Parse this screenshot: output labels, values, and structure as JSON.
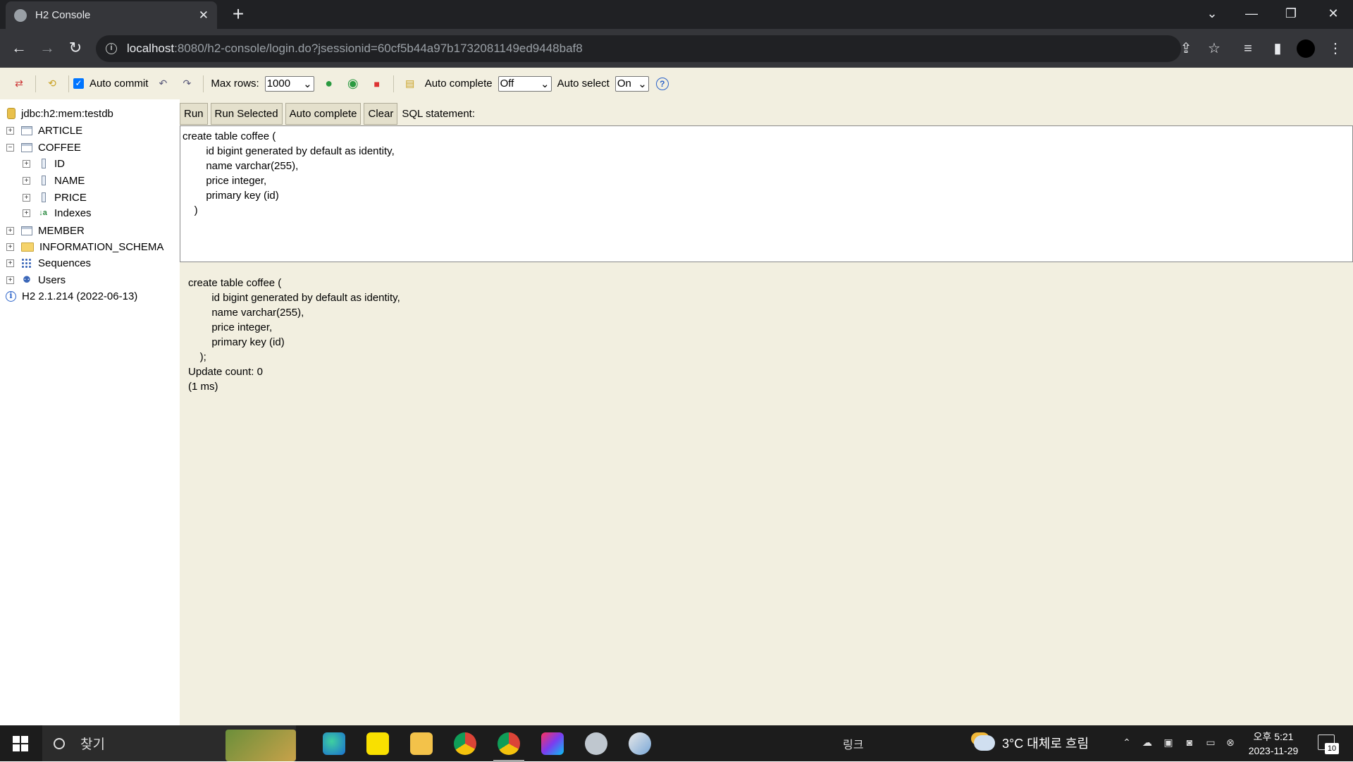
{
  "browser": {
    "tab_title": "H2 Console",
    "tab_close": "✕",
    "new_tab": "+",
    "url_host": "localhost",
    "url_rest": ":8080/h2-console/login.do?jsessionid=60cf5b44a97b1732081149ed9448baf8"
  },
  "h2_toolbar": {
    "auto_commit_label": "Auto commit",
    "auto_commit_checked": true,
    "max_rows_label": "Max rows:",
    "max_rows_value": "1000",
    "auto_complete_label": "Auto complete",
    "auto_complete_value": "Off",
    "auto_select_label": "Auto select",
    "auto_select_value": "On",
    "help": "?"
  },
  "tree": {
    "connection": "jdbc:h2:mem:testdb",
    "tables": [
      "ARTICLE",
      "COFFEE",
      "MEMBER"
    ],
    "coffee_columns": [
      "ID",
      "NAME",
      "PRICE"
    ],
    "indexes_label": "Indexes",
    "schema": "INFORMATION_SCHEMA",
    "sequences": "Sequences",
    "users": "Users",
    "version": "H2 2.1.214 (2022-06-13)"
  },
  "sql_toolbar": {
    "run": "Run",
    "run_selected": "Run Selected",
    "auto_complete": "Auto complete",
    "clear": "Clear",
    "statement_label": "SQL statement:"
  },
  "editor_text": "create table coffee (\n        id bigint generated by default as identity,\n        name varchar(255),\n        price integer,\n        primary key (id)\n    )",
  "result": {
    "statement": "create table coffee (\n        id bigint generated by default as identity,\n        name varchar(255),\n        price integer,\n        primary key (id)\n    );",
    "update_count": "Update count: 0",
    "timing": "(1 ms)"
  },
  "taskbar": {
    "search_placeholder": "찾기",
    "link_label": "링크",
    "weather": "3°C  대체로 흐림",
    "time": "오후 5:21",
    "date": "2023-11-29",
    "notification_count": "10"
  },
  "colors": {
    "h2_background": "#f2efe0",
    "browser_dark": "#35363a",
    "taskbar": "#1c1c1c"
  }
}
